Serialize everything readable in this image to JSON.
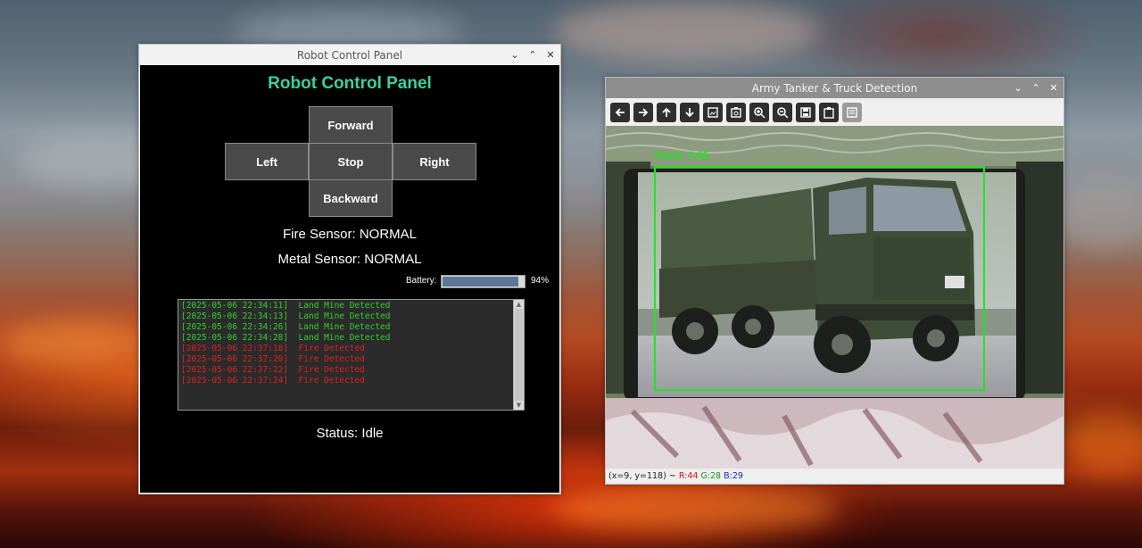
{
  "robot_window": {
    "title": "Robot Control Panel",
    "heading": "Robot Control Panel",
    "heading_color": "#3ad1a0",
    "buttons": {
      "forward": "Forward",
      "left": "Left",
      "stop": "Stop",
      "right": "Right",
      "backward": "Backward"
    },
    "fire_sensor": "Fire Sensor: NORMAL",
    "metal_sensor": "Metal Sensor: NORMAL",
    "battery_label": "Battery:",
    "battery_text": "94%",
    "battery_level": 0.94,
    "log": [
      {
        "text": "[2025-05-06 22:34:11]  Land Mine Detected",
        "color": "#2fd22f"
      },
      {
        "text": "[2025-05-06 22:34:13]  Land Mine Detected",
        "color": "#2fd22f"
      },
      {
        "text": "[2025-05-06 22:34:26]  Land Mine Detected",
        "color": "#2fd22f"
      },
      {
        "text": "[2025-05-06 22:34:28]  Land Mine Detected",
        "color": "#2fd22f"
      },
      {
        "text": "[2025-05-06 22:37:18]  Fire Detected",
        "color": "#e02020"
      },
      {
        "text": "[2025-05-06 22:37:20]  Fire Detected",
        "color": "#e02020"
      },
      {
        "text": "[2025-05-06 22:37:22]  Fire Detected",
        "color": "#e02020"
      },
      {
        "text": "[2025-05-06 22:37:24]  Fire Detected",
        "color": "#e02020"
      }
    ],
    "status": "Status: Idle"
  },
  "detection_window": {
    "title": "Army Tanker & Truck Detection",
    "toolbar": [
      {
        "name": "back-arrow-icon",
        "enabled": true
      },
      {
        "name": "forward-arrow-icon",
        "enabled": true
      },
      {
        "name": "up-arrow-icon",
        "enabled": true
      },
      {
        "name": "down-arrow-icon",
        "enabled": true
      },
      {
        "name": "fit-image-icon",
        "enabled": true
      },
      {
        "name": "image-settings-icon",
        "enabled": true
      },
      {
        "name": "zoom-in-icon",
        "enabled": true
      },
      {
        "name": "zoom-out-icon",
        "enabled": true
      },
      {
        "name": "save-icon",
        "enabled": true
      },
      {
        "name": "clipboard-icon",
        "enabled": true
      },
      {
        "name": "properties-icon",
        "enabled": false
      }
    ],
    "detection": {
      "label": "Truck: 0.85",
      "color": "#1ee81e"
    },
    "status_prefix": "(x=9, y=118) ~",
    "pixel_r": "R:44",
    "pixel_g": "G:28",
    "pixel_b": "B:29",
    "pixel_r_color": "#e01010",
    "pixel_g_color": "#10a010",
    "pixel_b_color": "#1020d0"
  },
  "window_controls": {
    "minimize": "⌄",
    "maximize": "⌃",
    "close": "✕"
  }
}
